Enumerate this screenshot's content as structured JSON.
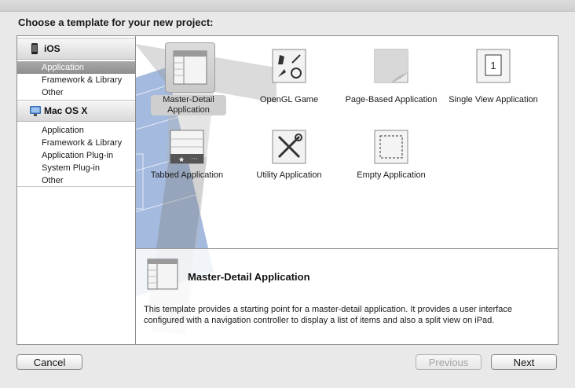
{
  "prompt": "Choose a template for your new project:",
  "sidebar": {
    "sections": [
      {
        "name": "iOS",
        "icon": "iphone-icon",
        "items": [
          "Application",
          "Framework & Library",
          "Other"
        ],
        "selected": "Application"
      },
      {
        "name": "Mac OS X",
        "icon": "mac-icon",
        "items": [
          "Application",
          "Framework & Library",
          "Application Plug-in",
          "System Plug-in",
          "Other"
        ]
      }
    ]
  },
  "templates": [
    {
      "label": "Master-Detail Application",
      "icon": "master-detail-icon",
      "selected": true
    },
    {
      "label": "OpenGL Game",
      "icon": "opengl-game-icon"
    },
    {
      "label": "Page-Based Application",
      "icon": "page-curl-icon"
    },
    {
      "label": "Single View Application",
      "icon": "single-view-icon"
    },
    {
      "label": "Tabbed Application",
      "icon": "tabbed-icon"
    },
    {
      "label": "Utility Application",
      "icon": "utility-tools-icon"
    },
    {
      "label": "Empty Application",
      "icon": "empty-dashed-icon"
    }
  ],
  "detail": {
    "title": "Master-Detail Application",
    "description": "This template provides a starting point for a master-detail application. It provides a user interface configured with a navigation controller to display a list of items and also a split view on iPad."
  },
  "buttons": {
    "cancel": "Cancel",
    "previous": "Previous",
    "next": "Next"
  }
}
